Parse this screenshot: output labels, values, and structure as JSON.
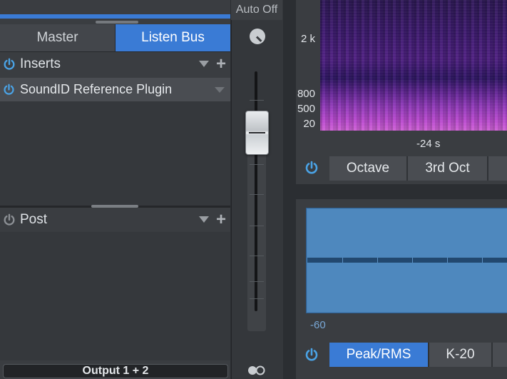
{
  "mixer": {
    "tabs": [
      {
        "label": "Master",
        "active": false
      },
      {
        "label": "Listen Bus",
        "active": true
      }
    ],
    "inserts": {
      "label": "Inserts",
      "slot": {
        "label": "SoundID Reference Plugin",
        "enabled": true
      }
    },
    "post": {
      "label": "Post"
    },
    "output": "Output 1 + 2",
    "automation": "Auto Off"
  },
  "spectrogram": {
    "freq_labels": [
      "2 k",
      "800",
      "500",
      "20"
    ],
    "time_label": "-24 s",
    "buttons": [
      "Octave",
      "3rd Oct"
    ]
  },
  "level_meter": {
    "scale_label": "-60",
    "buttons": [
      {
        "label": "Peak/RMS",
        "active": true
      },
      {
        "label": "K-20",
        "active": false
      }
    ]
  },
  "colors": {
    "accent": "#3a7bd5",
    "power_on": "#4aa3e6",
    "power_off": "#8c9095"
  },
  "icons": {
    "power": "power-icon",
    "add": "plus-icon",
    "dropdown": "triangle-down-icon",
    "pan": "pan-knob-icon",
    "link": "link-rings-icon"
  }
}
